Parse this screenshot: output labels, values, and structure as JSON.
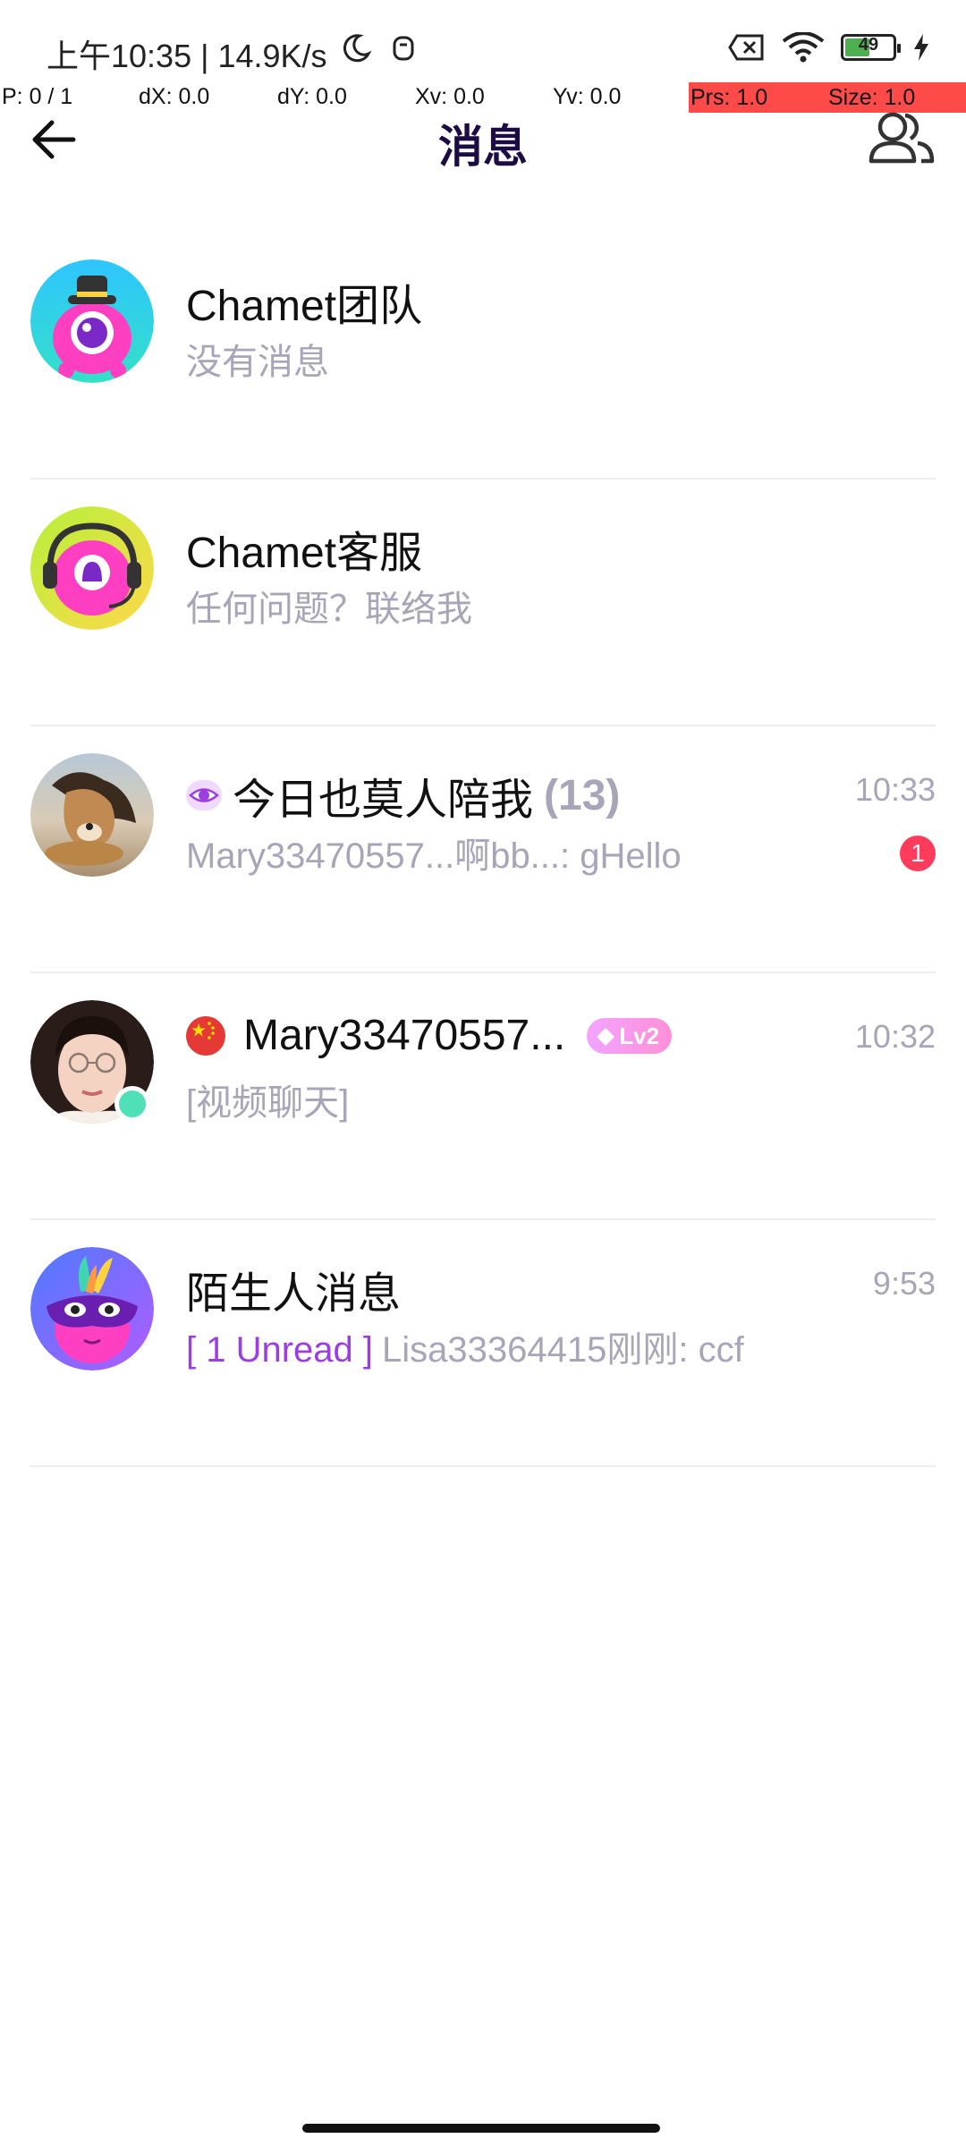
{
  "status_bar": {
    "time": "上午10:35 | 14.9K/s",
    "battery": "49"
  },
  "debug_bar": {
    "p": "P: 0 / 1",
    "dx": "dX: 0.0",
    "dy": "dY: 0.0",
    "xv": "Xv: 0.0",
    "yv": "Yv: 0.0",
    "prs": "Prs: 1.0",
    "size": "Size: 1.0"
  },
  "header": {
    "title": "消息"
  },
  "conversations": [
    {
      "name": "Chamet团队",
      "preview": "没有消息",
      "time": ""
    },
    {
      "name": "Chamet客服",
      "preview": "任何问题？联络我",
      "time": ""
    },
    {
      "name": "今日也莫人陪我",
      "count": "(13)",
      "preview": "Mary33470557...啊bb...: gHello",
      "time": "10:33",
      "badge": "1"
    },
    {
      "name": "Mary33470557...",
      "level": "Lv2",
      "preview": "[视频聊天]",
      "time": "10:32"
    },
    {
      "name": "陌生人消息",
      "unread": "[ 1 Unread ]",
      "preview": "Lisa33364415刚刚: ccf",
      "time": "9:53"
    }
  ],
  "colors": {
    "title": "#1d0b43",
    "badge": "#ff3c5c",
    "unread": "#9b3ddf",
    "muted": "#a9a5b8",
    "online": "#4fe0b8"
  }
}
